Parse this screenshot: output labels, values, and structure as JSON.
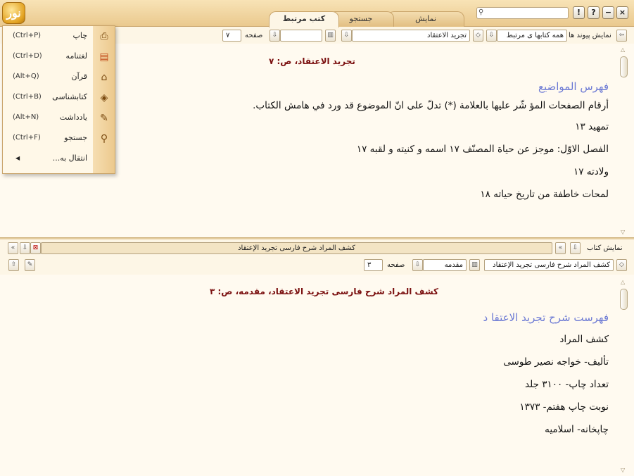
{
  "app": {
    "logo_text": "نور"
  },
  "tabs": [
    {
      "label": "کتب مرتبط",
      "active": true
    },
    {
      "label": "جستجو",
      "active": false
    },
    {
      "label": "نمایش",
      "active": false
    }
  ],
  "search": {
    "value": ""
  },
  "window_controls": {
    "help": "?",
    "info": "!",
    "minimize": "−",
    "close": "×"
  },
  "top_toolbar": {
    "show_links_label": "نمایش پیوند ها",
    "linked_books_select": "همه کتابها ی مرتبط",
    "book_select": "تجرید الاعتقاد",
    "section_select": "",
    "page_label": "صفحه",
    "page_value": "۷"
  },
  "top_pane": {
    "page_header": "تجرید الاعتقاد، ص: ۷",
    "lines": [
      "فهرس المواضيع",
      "أرقام الصفحات المؤ شّر عليها بالعلامة (*) تدلّ على انّ الموضوع قد ورد في هامش الكتاب.",
      "تمهيد ۱۳",
      "الفصل الاوّل: موجز عن حياة المصنّف ۱۷ اسمه و كنيته و لقبه ۱۷",
      "ولادته ۱۷",
      "لمحات خاطفة من تاريخ حياته ۱۸"
    ]
  },
  "bottom_toolbar_1": {
    "show_book_label": "نمایش کتاب",
    "book_title": "کشف المراد شرح فارسی تجريد الإعتقاد"
  },
  "bottom_toolbar_2": {
    "book_select": "کشف المراد شرح فارسی تجريد الإعتقاد",
    "section_select": "مقدمه",
    "page_label": "صفحه",
    "page_value": "۳"
  },
  "bottom_pane": {
    "page_header": "کشف المراد شرح فارسی تجريد الاعتقاد، مقدمه، ص: ۳",
    "lines": [
      "فهرست شرح تجريد الاعتقا د",
      "كشف المراد",
      "تأليف- خواجه نصير طوسى",
      "تعداد چاپ- ۳۱۰۰ جلد",
      "نوبت چاپ هفتم- ۱۳۷۳",
      "چاپخانه- اسلاميه"
    ]
  },
  "menu": {
    "items": [
      {
        "label": "چاپ",
        "shortcut": "(Ctrl+P)",
        "icon": "printer-icon"
      },
      {
        "label": "لغتنامه",
        "shortcut": "(Ctrl+D)",
        "icon": "dictionary-icon"
      },
      {
        "label": "قرآن",
        "shortcut": "(Alt+Q)",
        "icon": "quran-icon"
      },
      {
        "label": "کتابشناسی",
        "shortcut": "(Ctrl+B)",
        "icon": "bibliography-icon"
      },
      {
        "label": "يادداشت",
        "shortcut": "(Alt+N)",
        "icon": "note-icon"
      },
      {
        "label": "جستجو",
        "shortcut": "(Ctrl+F)",
        "icon": "search-icon"
      },
      {
        "label": "انتقال به...",
        "shortcut": "",
        "icon": ""
      }
    ]
  },
  "colors": {
    "accent": "#eac98e",
    "heading_blue": "#6b79d4",
    "page_header_red": "#7a0f0f",
    "background": "#fffaf0"
  }
}
